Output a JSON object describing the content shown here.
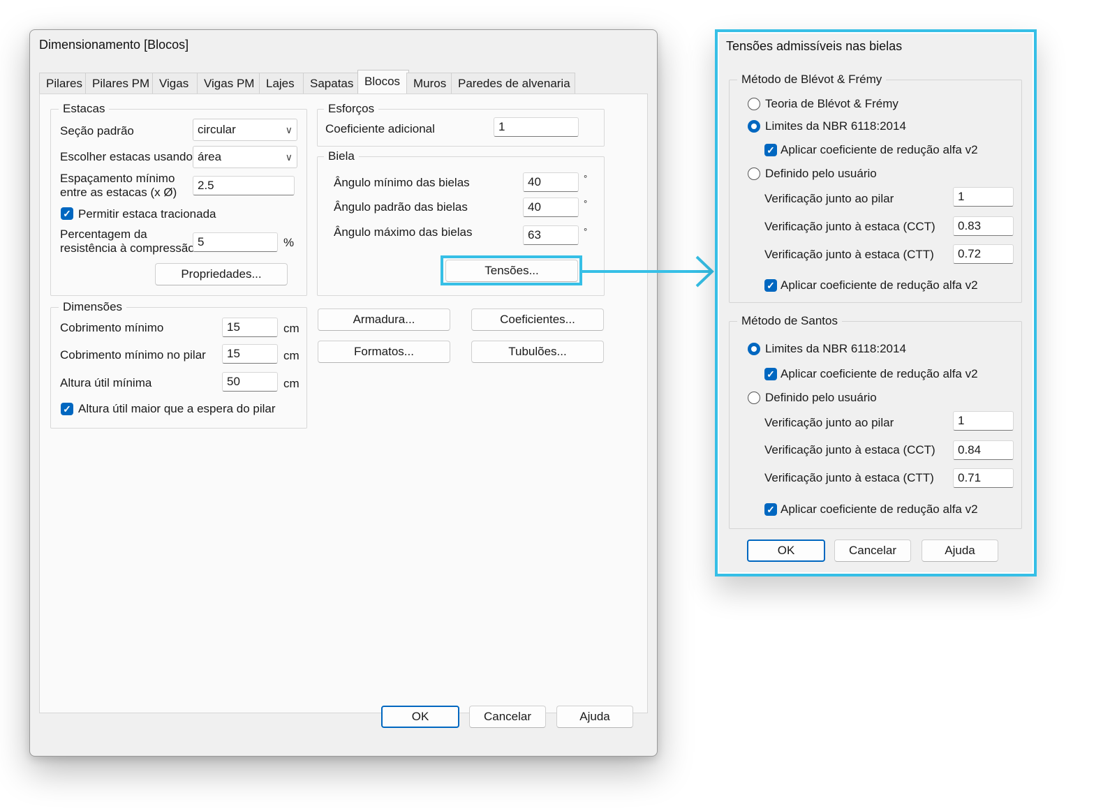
{
  "main_dialog": {
    "title": "Dimensionamento [Blocos]",
    "tabs": [
      "Pilares",
      "Pilares PM",
      "Vigas",
      "Vigas PM",
      "Lajes",
      "Sapatas",
      "Blocos",
      "Muros",
      "Paredes de alvenaria"
    ],
    "active_tab": "Blocos",
    "estacas": {
      "legend": "Estacas",
      "secao_label": "Seção padrão",
      "secao_value": "circular",
      "escolher_label": "Escolher estacas usando",
      "escolher_value": "área",
      "espacamento_label_1": "Espaçamento mínimo",
      "espacamento_label_2": "entre as estacas (x Ø)",
      "espacamento_value": "2.5",
      "permitir_label": "Permitir estaca tracionada",
      "percentagem_label_1": "Percentagem da",
      "percentagem_label_2": "resistência à compressão",
      "percentagem_value": "5",
      "percentagem_unit": "%",
      "propriedades_button": "Propriedades..."
    },
    "esforcos": {
      "legend": "Esforços",
      "coef_label": "Coeficiente adicional",
      "coef_value": "1"
    },
    "biela": {
      "legend": "Biela",
      "min_label": "Ângulo mínimo das bielas",
      "min_value": "40",
      "padrao_label": "Ângulo padrão das bielas",
      "padrao_value": "40",
      "max_label": "Ângulo máximo das bielas",
      "max_value": "63",
      "unit": "°",
      "tensoes_button": "Tensões..."
    },
    "dimensoes": {
      "legend": "Dimensões",
      "cobrimento_label": "Cobrimento mínimo",
      "cobrimento_value": "15",
      "cobrimento_pilar_label": "Cobrimento mínimo no pilar",
      "cobrimento_pilar_value": "15",
      "altura_label": "Altura útil mínima",
      "altura_value": "50",
      "unit": "cm",
      "altura_espera_label": "Altura útil maior que a espera do pilar"
    },
    "buttons": {
      "armadura": "Armadura...",
      "coeficientes": "Coeficientes...",
      "formatos": "Formatos...",
      "tubuloes": "Tubulões...",
      "ok": "OK",
      "cancelar": "Cancelar",
      "ajuda": "Ajuda"
    }
  },
  "tensoes_dialog": {
    "title": "Tensões admissíveis nas bielas",
    "blevot": {
      "legend": "Método de Blévot & Frémy",
      "teoria_label": "Teoria de Blévot & Frémy",
      "limites_label": "Limites da NBR 6118:2014",
      "aplicar_label_1": "Aplicar coeficiente de redução alfa v2",
      "definido_label": "Definido pelo usuário",
      "pilar_label": "Verificação junto ao pilar",
      "pilar_value": "1",
      "cct_label": "Verificação junto à estaca (CCT)",
      "cct_value": "0.83",
      "ctt_label": "Verificação junto à estaca (CTT)",
      "ctt_value": "0.72",
      "aplicar_label_2": "Aplicar coeficiente de redução alfa v2"
    },
    "santos": {
      "legend": "Método de Santos",
      "limites_label": "Limites da NBR 6118:2014",
      "aplicar_label_1": "Aplicar coeficiente de redução alfa v2",
      "definido_label": "Definido pelo usuário",
      "pilar_label": "Verificação junto ao pilar",
      "pilar_value": "1",
      "cct_label": "Verificação junto à estaca (CCT)",
      "cct_value": "0.84",
      "ctt_label": "Verificação junto à estaca (CTT)",
      "ctt_value": "0.71",
      "aplicar_label_2": "Aplicar coeficiente de redução alfa v2"
    },
    "buttons": {
      "ok": "OK",
      "cancelar": "Cancelar",
      "ajuda": "Ajuda"
    }
  },
  "colors": {
    "highlight": "#36bfe6",
    "accent": "#0067c0"
  },
  "icons": {
    "checkbox": "check-icon",
    "dropdown": "chevron-down-icon",
    "arrow": "right-arrow-icon"
  }
}
